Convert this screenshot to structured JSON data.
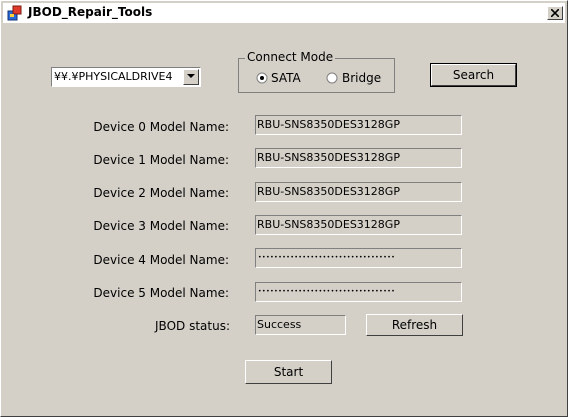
{
  "window": {
    "title": "JBOD_Repair_Tools",
    "close_glyph": "×"
  },
  "drive_select": {
    "selected": "¥¥.¥PHYSICALDRIVE4"
  },
  "connect_mode": {
    "caption": "Connect Mode",
    "options": [
      {
        "label": "SATA",
        "selected": true
      },
      {
        "label": "Bridge",
        "selected": false
      }
    ]
  },
  "search_button": {
    "label": "Search"
  },
  "devices": [
    {
      "label": "Device 0 Model Name:",
      "value": "RBU-SNS8350DES3128GP"
    },
    {
      "label": "Device 1 Model Name:",
      "value": "RBU-SNS8350DES3128GP"
    },
    {
      "label": "Device 2 Model Name:",
      "value": "RBU-SNS8350DES3128GP"
    },
    {
      "label": "Device 3 Model Name:",
      "value": "RBU-SNS8350DES3128GP"
    },
    {
      "label": "Device 4 Model Name:",
      "value": "••••••••••••••••••••••••••••••••••"
    },
    {
      "label": "Device 5 Model Name:",
      "value": "••••••••••••••••••••••••••••••••••"
    }
  ],
  "status": {
    "label": "JBOD status:",
    "value": "Success"
  },
  "refresh_button": {
    "label": "Refresh"
  },
  "start_button": {
    "label": "Start"
  },
  "colors": {
    "face": "#d4d0c8",
    "shadow": "#808080",
    "highlight": "#ffffff"
  }
}
